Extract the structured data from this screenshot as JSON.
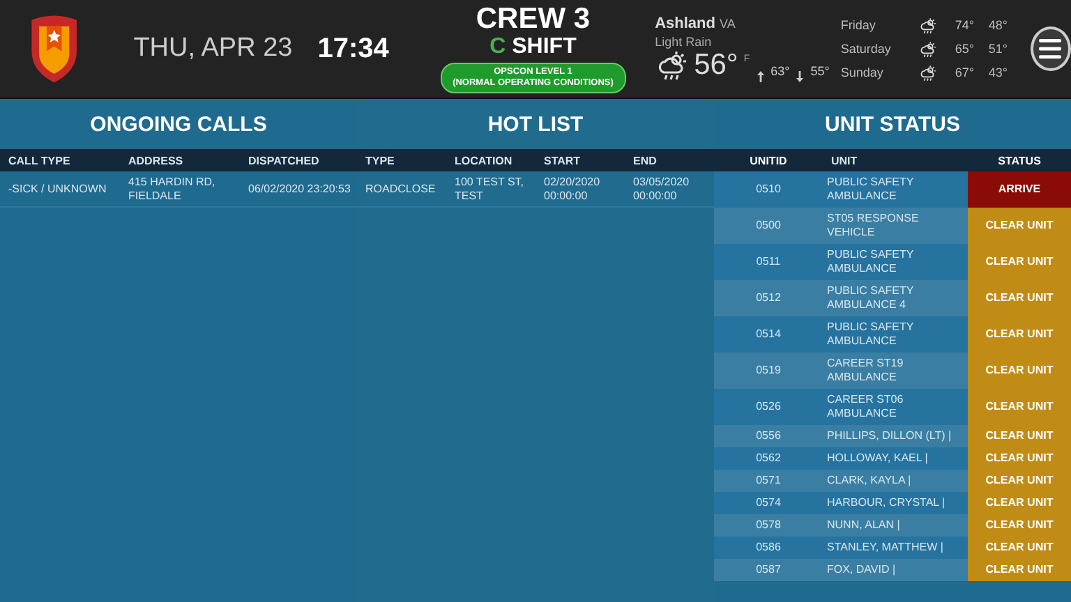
{
  "header": {
    "date": "THU, APR 23",
    "time": "17:34",
    "crew": "CREW 3",
    "shift_letter": "C",
    "shift": "SHIFT",
    "opscon": [
      "OPSCON LEVEL 1",
      "(NORMAL OPERATING CONDITIONS)"
    ],
    "weather": {
      "city": "Ashland",
      "state": "VA",
      "condition": "Light Rain",
      "temp": "56°",
      "unit": "F",
      "high": "63°",
      "low": "55°",
      "forecast": [
        {
          "day": "Friday",
          "high": "74°",
          "low": "48°"
        },
        {
          "day": "Saturday",
          "high": "65°",
          "low": "51°"
        },
        {
          "day": "Sunday",
          "high": "67°",
          "low": "43°"
        }
      ]
    }
  },
  "ongoing_calls": {
    "title": "ONGOING CALLS",
    "columns": [
      "CALL TYPE",
      "ADDRESS",
      "DISPATCHED"
    ],
    "rows": [
      [
        "-SICK / UNKNOWN",
        "415 HARDIN RD, FIELDALE",
        "06/02/2020 23:20:53"
      ]
    ]
  },
  "hot_list": {
    "title": "HOT LIST",
    "columns": [
      "TYPE",
      "LOCATION",
      "START",
      "END"
    ],
    "rows": [
      [
        "ROADCLOSE",
        "100 TEST ST, TEST",
        "02/20/2020 00:00:00",
        "03/05/2020 00:00:00"
      ]
    ]
  },
  "unit_status": {
    "title": "UNIT STATUS",
    "columns": [
      "UNITID",
      "UNIT",
      "STATUS"
    ],
    "rows": [
      {
        "id": "0510",
        "unit": "PUBLIC SAFETY AMBULANCE",
        "status": "ARRIVE",
        "kind": "arrive"
      },
      {
        "id": "0500",
        "unit": "ST05 RESPONSE VEHICLE",
        "status": "CLEAR UNIT",
        "kind": "clear"
      },
      {
        "id": "0511",
        "unit": "PUBLIC SAFETY AMBULANCE",
        "status": "CLEAR UNIT",
        "kind": "clear"
      },
      {
        "id": "0512",
        "unit": "PUBLIC SAFETY AMBULANCE 4",
        "status": "CLEAR UNIT",
        "kind": "clear"
      },
      {
        "id": "0514",
        "unit": "PUBLIC SAFETY AMBULANCE",
        "status": "CLEAR UNIT",
        "kind": "clear"
      },
      {
        "id": "0519",
        "unit": "CAREER ST19 AMBULANCE",
        "status": "CLEAR UNIT",
        "kind": "clear"
      },
      {
        "id": "0526",
        "unit": "CAREER ST06 AMBULANCE",
        "status": "CLEAR UNIT",
        "kind": "clear"
      },
      {
        "id": "0556",
        "unit": "PHILLIPS, DILLON (LT) |",
        "status": "CLEAR UNIT",
        "kind": "clear"
      },
      {
        "id": "0562",
        "unit": "HOLLOWAY, KAEL |",
        "status": "CLEAR UNIT",
        "kind": "clear"
      },
      {
        "id": "0571",
        "unit": "CLARK, KAYLA |",
        "status": "CLEAR UNIT",
        "kind": "clear"
      },
      {
        "id": "0574",
        "unit": "HARBOUR, CRYSTAL |",
        "status": "CLEAR UNIT",
        "kind": "clear"
      },
      {
        "id": "0578",
        "unit": "NUNN, ALAN |",
        "status": "CLEAR UNIT",
        "kind": "clear"
      },
      {
        "id": "0586",
        "unit": "STANLEY, MATTHEW |",
        "status": "CLEAR UNIT",
        "kind": "clear"
      },
      {
        "id": "0587",
        "unit": "FOX, DAVID |",
        "status": "CLEAR UNIT",
        "kind": "clear"
      }
    ]
  }
}
